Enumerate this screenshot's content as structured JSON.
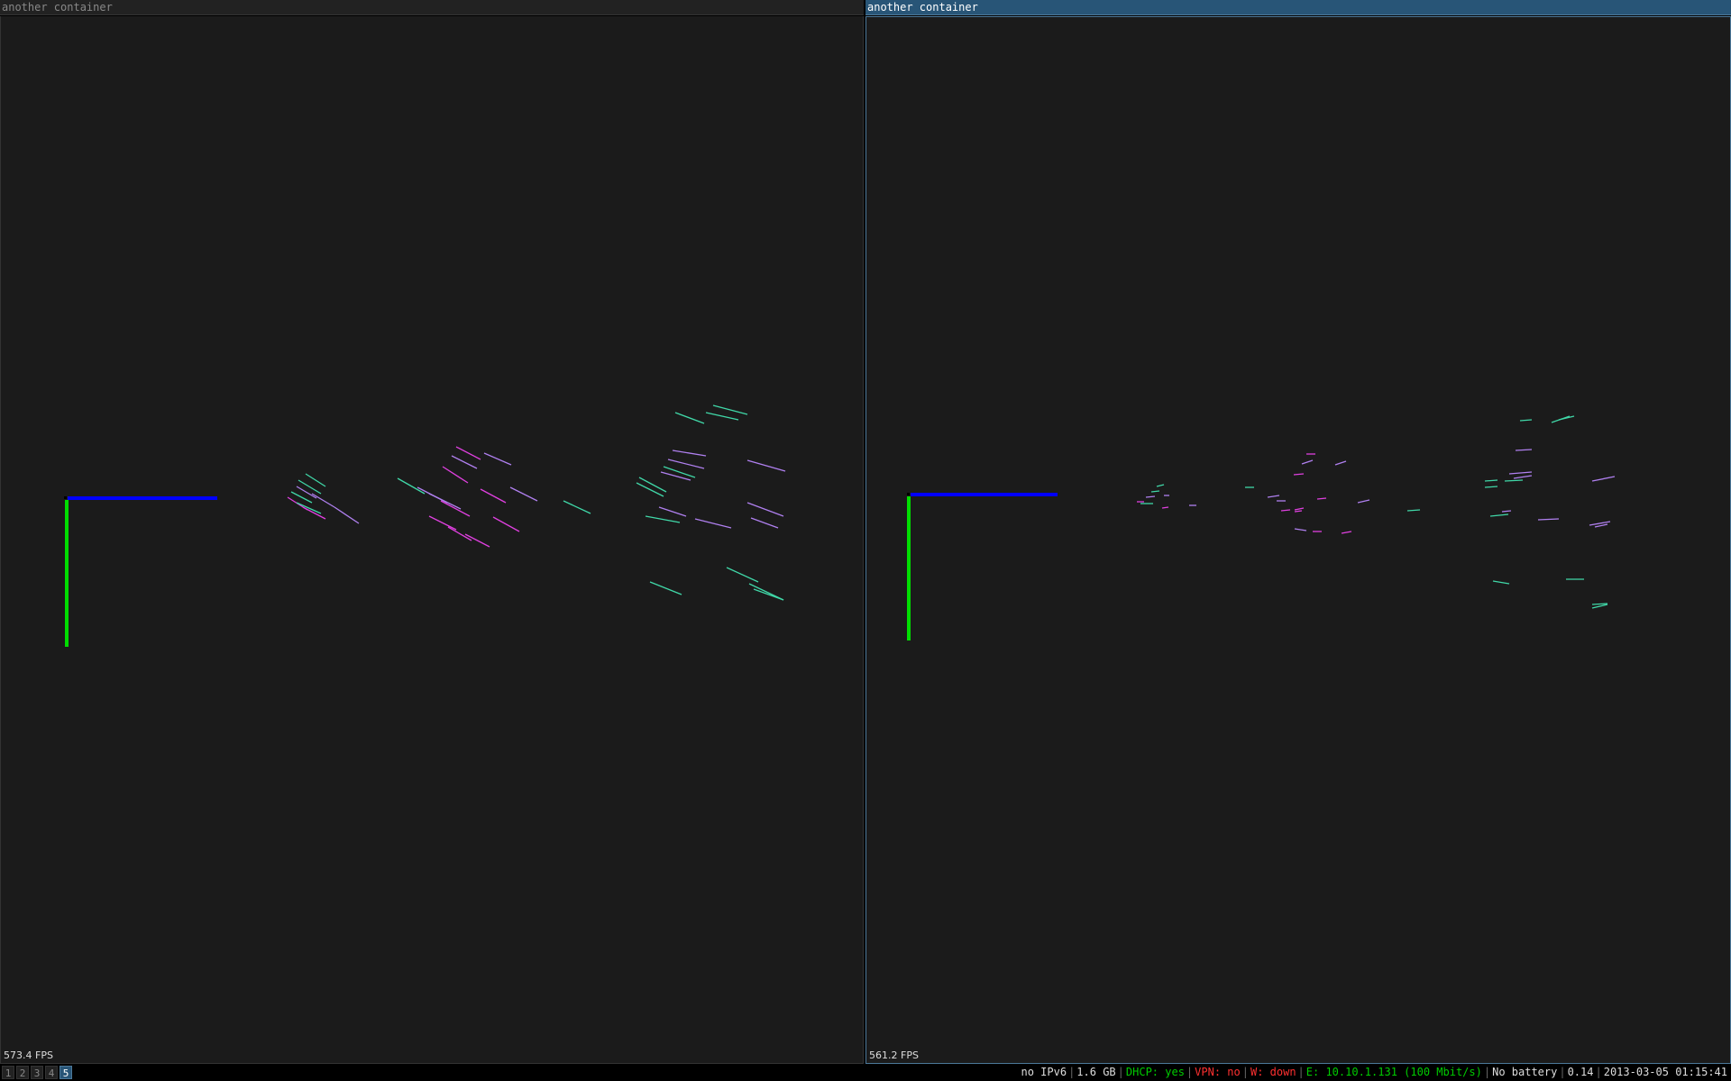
{
  "windows": [
    {
      "title": "another container",
      "fps": "573.4 FPS"
    },
    {
      "title": "another container",
      "fps": "561.2 FPS"
    }
  ],
  "workspaces": [
    "1",
    "2",
    "3",
    "4",
    "5"
  ],
  "active_workspace": "5",
  "status": {
    "ipv6": "no IPv6",
    "disk": "1.6 GB",
    "dhcp": "DHCP: yes",
    "vpn": "VPN: no",
    "wireless": "W: down",
    "ethernet": "E: 10.10.1.131 (100 Mbit/s)",
    "battery": "No battery",
    "load": "0.14",
    "datetime": "2013-03-05 01:15:41"
  },
  "colors": {
    "cyan_line": "#40d8a8",
    "magenta_line": "#e040e0",
    "violet_line": "#b080f0",
    "axis_x": "#0000ff",
    "axis_y": "#00dd00",
    "focus": "#285577",
    "canvas": "#1b1b1b"
  }
}
